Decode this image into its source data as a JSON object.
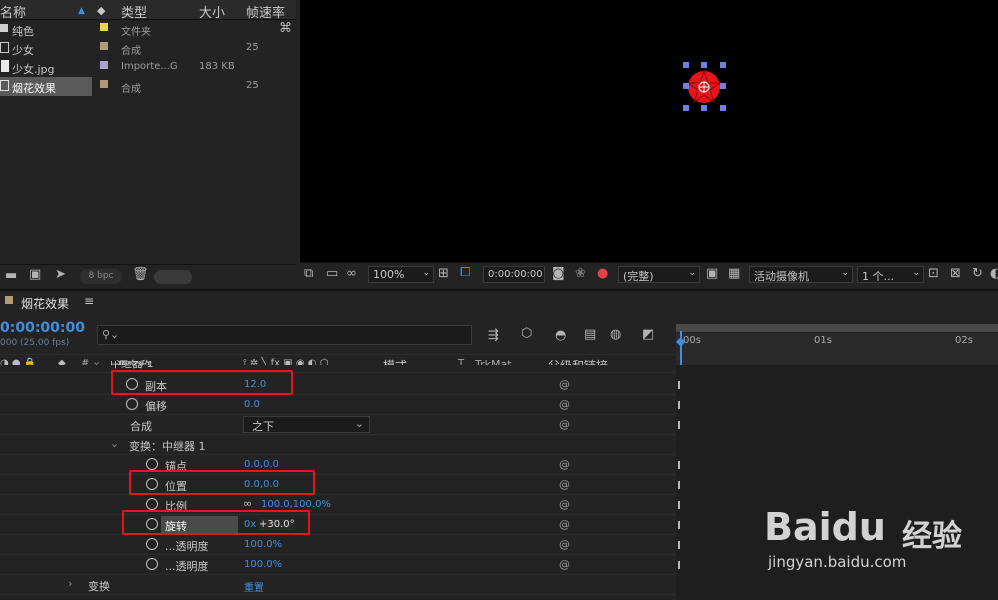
{
  "project": {
    "columns": {
      "name": "名称",
      "type": "类型",
      "size": "大小",
      "framerate": "帧速率"
    },
    "items": [
      {
        "name": "纯色",
        "type": "文件夹",
        "size": "",
        "fps": "",
        "color": "#e8d64a"
      },
      {
        "name": "少女",
        "type": "合成",
        "size": "",
        "fps": "25",
        "color": "#b39b7a"
      },
      {
        "name": "少女.jpg",
        "type": "Importe...G",
        "size": "183 KB",
        "fps": "",
        "color": "#a9a4cf"
      },
      {
        "name": "烟花效果",
        "type": "合成",
        "size": "",
        "fps": "25",
        "color": "#b39b7a"
      }
    ],
    "footer": {
      "bpc": "8 bpc"
    }
  },
  "viewer": {
    "zoom": "100%",
    "timecode": "0:00:00:00",
    "resolution": "(完整)",
    "camera": "活动摄像机",
    "views": "1 个..."
  },
  "timeline": {
    "comp_tab": "烟花效果",
    "timecode": "0:00:00:00",
    "fps_hint": "000 (25.00 fps)",
    "search_placeholder": "",
    "headers": {
      "hash": "#",
      "source_name": "源名称",
      "mode": "模式",
      "t": "T",
      "trkmat": "TrkMat",
      "parent": "父级和链接"
    },
    "ruler": [
      "00s",
      "01s",
      "02s"
    ],
    "rows": [
      {
        "label": "中继器 1",
        "value": ""
      },
      {
        "label": "副本",
        "value": "12.0"
      },
      {
        "label": "偏移",
        "value": "0.0"
      },
      {
        "label": "合成",
        "value": "之下"
      },
      {
        "label": "变换：中继器 1",
        "value": ""
      },
      {
        "label": "锚点",
        "value": "0.0,0.0"
      },
      {
        "label": "位置",
        "value": "0.0,0.0"
      },
      {
        "label": "比例",
        "value": "100.0,100.0%"
      },
      {
        "label": "旋转",
        "value_a": "0x",
        "value_b": "+30.0°"
      },
      {
        "label": "...透明度",
        "value": "100.0%"
      },
      {
        "label": "...透明度",
        "value": "100.0%"
      },
      {
        "label": "变换",
        "value": "重置"
      }
    ]
  },
  "watermark": {
    "brand": "Baidu",
    "cn": "经验",
    "url": "jingyan.baidu.com"
  },
  "colors": {
    "accent": "#3f8fe0",
    "highlight": "#e8141b",
    "star": "#e8141b",
    "handle": "#6f7fe6"
  }
}
